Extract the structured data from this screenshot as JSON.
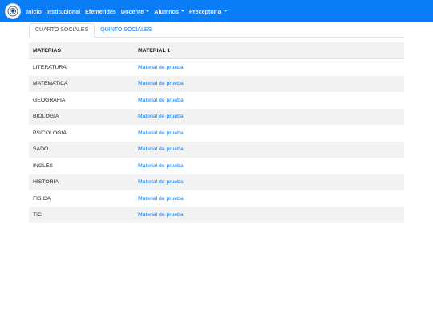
{
  "nav": {
    "items": [
      {
        "label": "Inicio",
        "dropdown": false
      },
      {
        "label": "Institucional",
        "dropdown": false
      },
      {
        "label": "Efemerides",
        "dropdown": false
      },
      {
        "label": "Docente",
        "dropdown": true
      },
      {
        "label": "Alumnos",
        "dropdown": true
      },
      {
        "label": "Preceptoria",
        "dropdown": true
      }
    ]
  },
  "tabs": [
    {
      "label": "CUARTO SOCIALES",
      "active": true
    },
    {
      "label": "QUINTO SOCIALES",
      "active": false
    }
  ],
  "table": {
    "headers": [
      "MATERIAS",
      "MATERIAL 1"
    ],
    "rows": [
      {
        "materia": "LITERATURA",
        "material": "Material de prueba"
      },
      {
        "materia": "MATEMATICA",
        "material": "Material de prueba"
      },
      {
        "materia": "GEOGRAFIA",
        "material": "Material de prueba"
      },
      {
        "materia": "BIOLOGIA",
        "material": "Material de prueba"
      },
      {
        "materia": "PSICOLOGIA",
        "material": "Material de prueba"
      },
      {
        "materia": "SADO",
        "material": "Material de prueba"
      },
      {
        "materia": "INGLES",
        "material": "Material de prueba"
      },
      {
        "materia": "HISTORIA",
        "material": "Material de prueba"
      },
      {
        "materia": "FISICA",
        "material": "Material de prueba"
      },
      {
        "materia": "TIC",
        "material": "Material de prueba"
      }
    ]
  },
  "colors": {
    "navbar": "#0a7cf5",
    "link": "#0a7cf5",
    "stripe": "#f2f2f2"
  },
  "icons": {
    "logo": "school-crest-icon"
  }
}
